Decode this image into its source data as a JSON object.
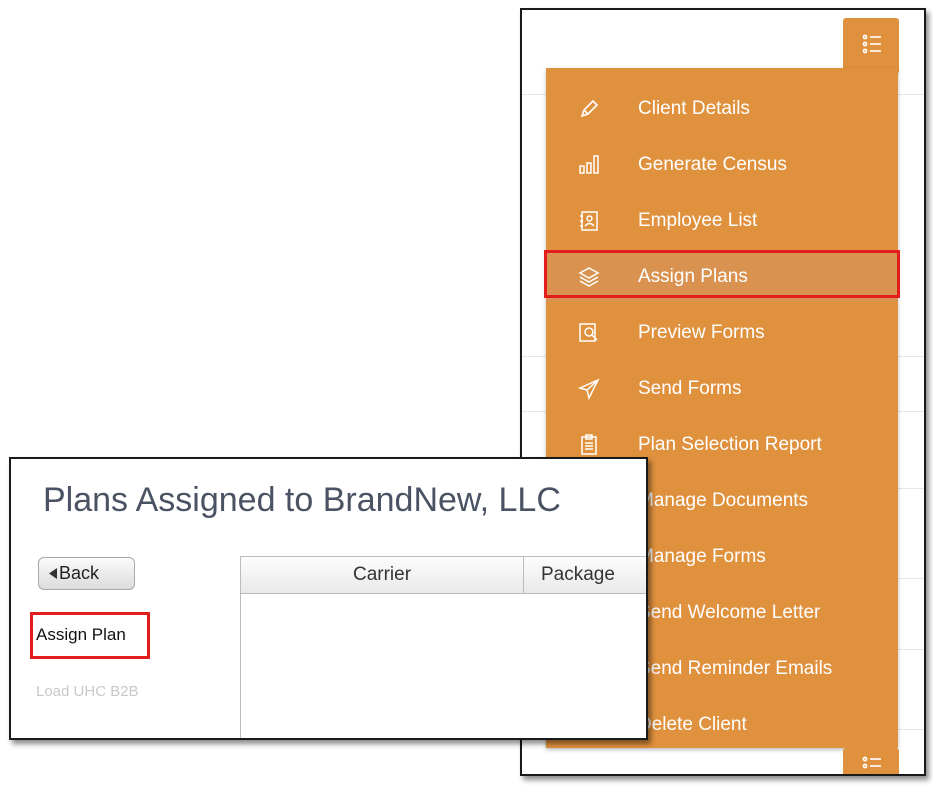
{
  "menu": {
    "items": [
      {
        "label": "Client Details",
        "icon": "pencil-icon"
      },
      {
        "label": "Generate Census",
        "icon": "bar-chart-icon"
      },
      {
        "label": "Employee List",
        "icon": "contacts-book-icon"
      },
      {
        "label": "Assign Plans",
        "icon": "layers-icon",
        "active": true
      },
      {
        "label": "Preview Forms",
        "icon": "preview-icon"
      },
      {
        "label": "Send Forms",
        "icon": "paper-plane-icon"
      },
      {
        "label": "Plan Selection Report",
        "icon": "clipboard-icon"
      },
      {
        "label": "Manage Documents",
        "icon": "folder-icon"
      },
      {
        "label": "Manage Forms",
        "icon": "forms-icon"
      },
      {
        "label": "Send Welcome Letter",
        "icon": "envelope-icon"
      },
      {
        "label": "Send Reminder Emails",
        "icon": "bell-icon"
      },
      {
        "label": "Delete Client",
        "icon": "trash-icon"
      }
    ],
    "toggle_icon": "list-icon"
  },
  "plans": {
    "title": "Plans Assigned to BrandNew, LLC",
    "back_label": "Back",
    "assign_plan_label": "Assign Plan",
    "load_uhc_label": "Load UHC B2B",
    "table": {
      "columns": [
        "Carrier",
        "Package"
      ]
    }
  },
  "colors": {
    "menu_bg": "#e0913d",
    "menu_active": "#d9924f",
    "highlight": "#e21d1d",
    "title_text": "#4a5363"
  }
}
